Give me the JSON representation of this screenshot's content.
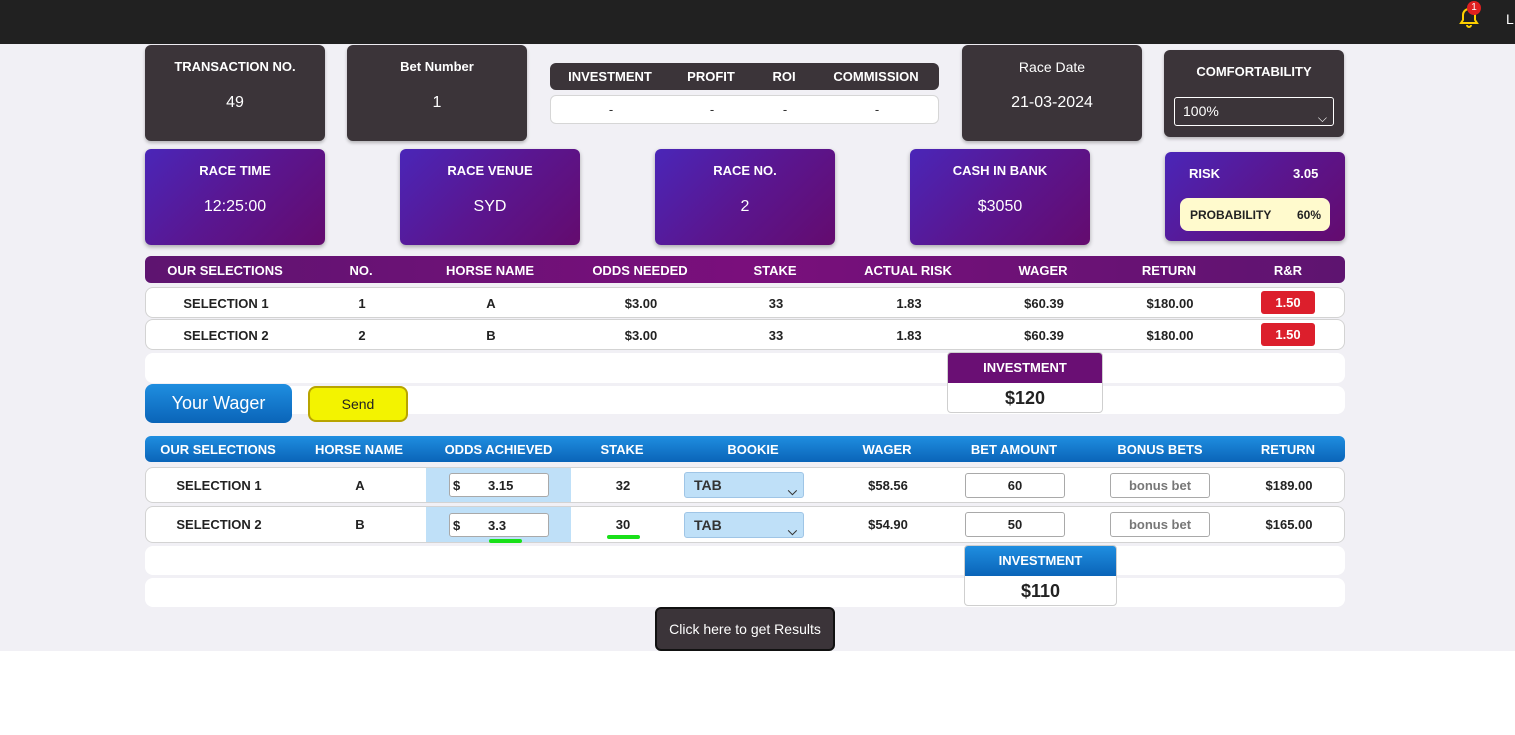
{
  "header": {
    "notification_count": "1",
    "user_initial": "L"
  },
  "top_cards": {
    "transaction": {
      "label": "TRANSACTION NO.",
      "value": "49"
    },
    "bet_number": {
      "label": "Bet Number",
      "value": "1"
    },
    "summary": {
      "headers": [
        "INVESTMENT",
        "PROFIT",
        "ROI",
        "COMMISSION"
      ],
      "values": [
        "-",
        "-",
        "-",
        "-"
      ]
    },
    "race_date": {
      "label": "Race Date",
      "value": "21-03-2024"
    },
    "comfortability": {
      "label": "COMFORTABILITY",
      "selected": "100%"
    }
  },
  "race_cards": {
    "race_time": {
      "label": "RACE TIME",
      "value": "12:25:00"
    },
    "race_venue": {
      "label": "RACE VENUE",
      "value": "SYD"
    },
    "race_no": {
      "label": "RACE NO.",
      "value": "2"
    },
    "cash_in_bank": {
      "label": "CASH IN BANK",
      "value": "$3050"
    },
    "risk": {
      "label": "RISK",
      "value": "3.05",
      "probability_label": "PROBABILITY",
      "probability_value": "60%"
    }
  },
  "selections_table": {
    "headers": [
      "OUR SELECTIONS",
      "NO.",
      "HORSE NAME",
      "ODDS NEEDED",
      "STAKE",
      "ACTUAL RISK",
      "WAGER",
      "RETURN",
      "R&R"
    ],
    "rows": [
      [
        "SELECTION 1",
        "1",
        "A",
        "$3.00",
        "33",
        "1.83",
        "$60.39",
        "$180.00",
        "1.50"
      ],
      [
        "SELECTION 2",
        "2",
        "B",
        "$3.00",
        "33",
        "1.83",
        "$60.39",
        "$180.00",
        "1.50"
      ]
    ],
    "investment_label": "INVESTMENT",
    "investment_value": "$120"
  },
  "wager": {
    "title": "Your Wager",
    "send_label": "Send",
    "headers": [
      "OUR SELECTIONS",
      "HORSE NAME",
      "ODDS ACHIEVED",
      "STAKE",
      "BOOKIE",
      "WAGER",
      "BET AMOUNT",
      "BONUS BETS",
      "RETURN"
    ],
    "currency_symbol": "$",
    "rows": [
      {
        "selection": "SELECTION 1",
        "horse": "A",
        "odds": "3.15",
        "stake": "32",
        "bookie": "TAB",
        "wager": "$58.56",
        "bet_amount": "60",
        "bonus_placeholder": "bonus bet",
        "return": "$189.00"
      },
      {
        "selection": "SELECTION 2",
        "horse": "B",
        "odds": "3.3",
        "stake": "30",
        "bookie": "TAB",
        "wager": "$54.90",
        "bet_amount": "50",
        "bonus_placeholder": "bonus bet",
        "return": "$165.00"
      }
    ],
    "investment_label": "INVESTMENT",
    "investment_value": "$110"
  },
  "results_button": "Click here to get Results",
  "colors": {
    "dark_card": "#3b3439",
    "purple": "#5a1690",
    "blue": "#0a64b8",
    "rr_red": "#dc1f2c",
    "send_yellow": "#f3f300",
    "annotation_green": "#19e019"
  }
}
